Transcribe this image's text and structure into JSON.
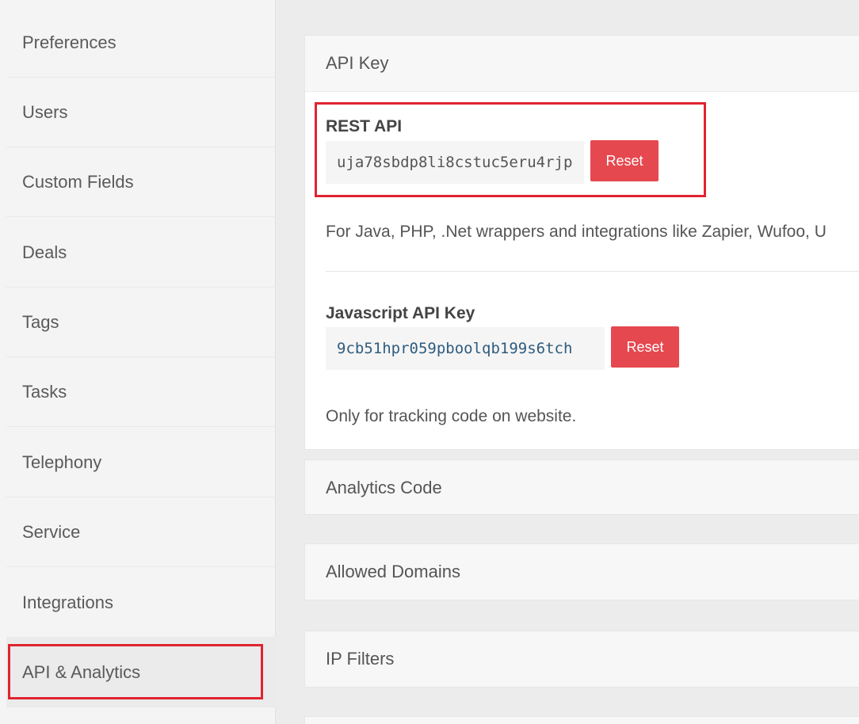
{
  "sidebar": {
    "items": [
      {
        "label": "Preferences"
      },
      {
        "label": "Users"
      },
      {
        "label": "Custom Fields"
      },
      {
        "label": "Deals"
      },
      {
        "label": "Tags"
      },
      {
        "label": "Tasks"
      },
      {
        "label": "Telephony"
      },
      {
        "label": "Service"
      },
      {
        "label": "Integrations"
      },
      {
        "label": "API & Analytics",
        "active": true
      }
    ]
  },
  "api_key_panel": {
    "title": "API Key",
    "rest": {
      "title": "REST API",
      "key": "uja78sbdp8li8cstuc5eru4rjp",
      "reset_label": "Reset",
      "help": "For Java, PHP, .Net wrappers and integrations like Zapier, Wufoo, U"
    },
    "javascript": {
      "title": "Javascript API Key",
      "key": "9cb51hpr059pboolqb199s6tch",
      "reset_label": "Reset",
      "help": "Only for tracking code on website."
    }
  },
  "panels": {
    "analytics_code": "Analytics Code",
    "allowed_domains": "Allowed Domains",
    "ip_filters": "IP Filters"
  },
  "colors": {
    "highlight": "#e02431",
    "reset_button": "#e6484f"
  }
}
